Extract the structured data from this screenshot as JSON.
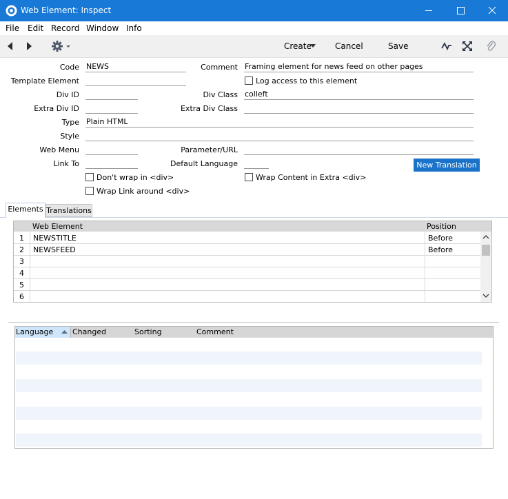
{
  "window": {
    "title": "Web Element: Inspect"
  },
  "menu": [
    "File",
    "Edit",
    "Record",
    "Window",
    "Info"
  ],
  "toolbar": {
    "create_label": "Create",
    "cancel_label": "Cancel",
    "save_label": "Save"
  },
  "form": {
    "code_label": "Code",
    "code_value": "NEWS",
    "template_label": "Template Element",
    "template_value": "",
    "divid_label": "Div ID",
    "divid_value": "",
    "extradivid_label": "Extra Div ID",
    "extradivid_value": "",
    "type_label": "Type",
    "type_value": "Plain HTML",
    "style_label": "Style",
    "style_value": "",
    "webmenu_label": "Web Menu",
    "webmenu_value": "",
    "linkto_label": "Link To",
    "linkto_value": "",
    "comment_label": "Comment",
    "comment_value": "Framing element for news feed on other pages",
    "log_access_label": "Log access to this element",
    "divclass_label": "Div Class",
    "divclass_value": "colleft",
    "extradivclass_label": "Extra Div Class",
    "extradivclass_value": "",
    "paramurl_label": "Parameter/URL",
    "paramurl_value": "",
    "deflang_label": "Default Language",
    "deflang_value": "",
    "new_translation_label": "New Translation",
    "dont_wrap_label": "Don't wrap in <div>",
    "wrap_content_label": "Wrap Content in Extra <div>",
    "wrap_link_label": "Wrap Link around <div>"
  },
  "tabs": {
    "elements": "Elements",
    "translations": "Translations"
  },
  "elements_grid": {
    "col_element": "Web Element",
    "col_position": "Position",
    "rows": [
      {
        "num": "1",
        "element": "NEWSTITLE",
        "position": "Before"
      },
      {
        "num": "2",
        "element": "NEWSFEED",
        "position": "Before"
      },
      {
        "num": "3",
        "element": "",
        "position": ""
      },
      {
        "num": "4",
        "element": "",
        "position": ""
      },
      {
        "num": "5",
        "element": "",
        "position": ""
      },
      {
        "num": "6",
        "element": "",
        "position": ""
      }
    ]
  },
  "translations_table": {
    "col_language": "Language",
    "col_changed": "Changed",
    "col_sorting": "Sorting",
    "col_comment": "Comment"
  },
  "colors": {
    "titlebar": "#1879d6",
    "accent_button": "#1a73c9",
    "stripe": "#f0f5fb"
  }
}
